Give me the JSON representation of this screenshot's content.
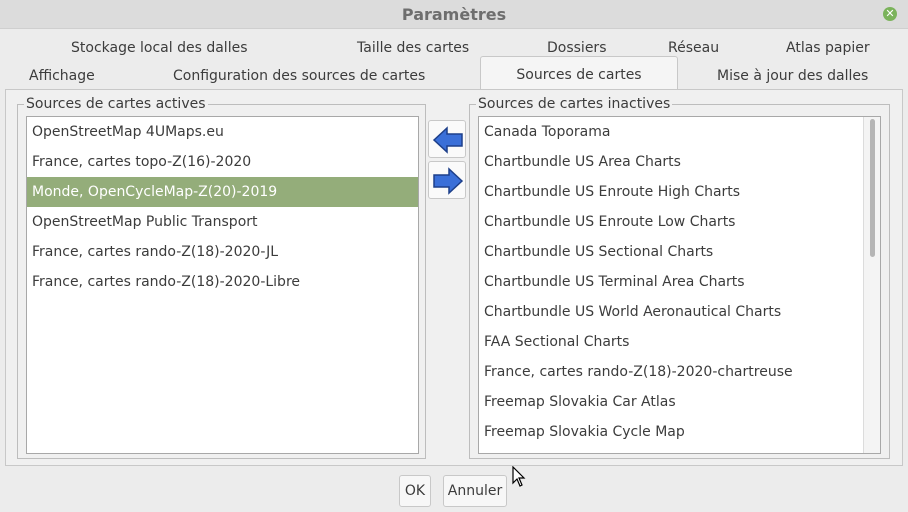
{
  "window": {
    "title": "Paramètres"
  },
  "tabs": {
    "row1": [
      {
        "label": "Stockage local des dalles"
      },
      {
        "label": "Taille des cartes"
      },
      {
        "label": "Dossiers"
      },
      {
        "label": "Réseau"
      },
      {
        "label": "Atlas papier"
      }
    ],
    "row2": [
      {
        "label": "Affichage"
      },
      {
        "label": "Configuration des sources de cartes"
      },
      {
        "label": "Sources de cartes",
        "active": true
      },
      {
        "label": "Mise à jour des dalles"
      }
    ]
  },
  "active_sources": {
    "title": "Sources de cartes actives",
    "items": [
      "OpenStreetMap 4UMaps.eu",
      "France, cartes topo-Z(16)-2020",
      "Monde, OpenCycleMap-Z(20)-2019",
      "OpenStreetMap Public Transport",
      "France, cartes rando-Z(18)-2020-JL",
      "France, cartes rando-Z(18)-2020-Libre"
    ],
    "selected_index": 2
  },
  "inactive_sources": {
    "title": "Sources de cartes inactives",
    "items": [
      "Canada Toporama",
      "Chartbundle US Area Charts",
      "Chartbundle US Enroute High Charts",
      "Chartbundle US Enroute Low Charts",
      "Chartbundle US Sectional Charts",
      "Chartbundle US Terminal Area Charts",
      "Chartbundle US World Aeronautical Charts",
      "FAA Sectional Charts",
      "France, cartes rando-Z(18)-2020-chartreuse",
      "Freemap Slovakia Car Atlas",
      "Freemap Slovakia Cycle Map"
    ]
  },
  "buttons": {
    "ok": "OK",
    "cancel": "Annuler"
  },
  "colors": {
    "selection": "#94ad7a",
    "arrow": "#3a6fd8",
    "close": "#7bb35b"
  }
}
